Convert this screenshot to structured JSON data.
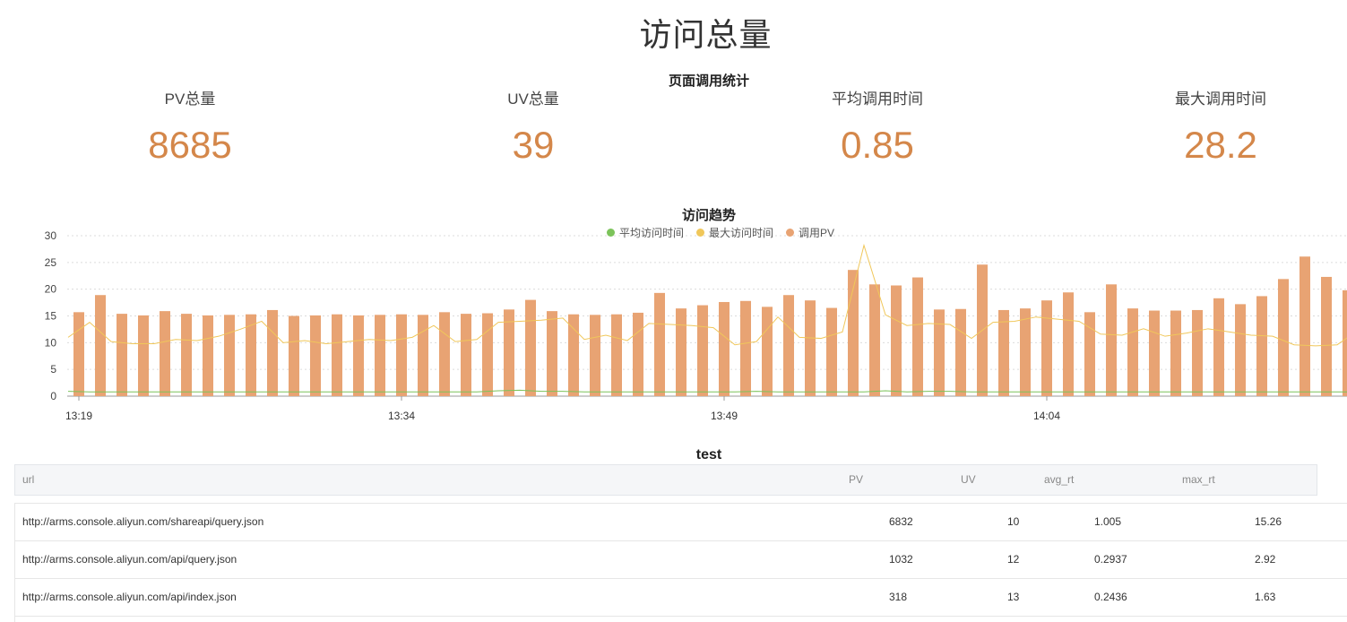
{
  "page": {
    "title": "访问总量"
  },
  "stats": {
    "title": "页面调用统计",
    "kpis": [
      {
        "label": "PV总量",
        "value": "8685"
      },
      {
        "label": "UV总量",
        "value": "39"
      },
      {
        "label": "平均调用时间",
        "value": "0.85"
      },
      {
        "label": "最大调用时间",
        "value": "28.2"
      }
    ]
  },
  "colors": {
    "accent": "#d4874a",
    "bar": "#e8a373",
    "avg_line": "#7cc35a",
    "max_line": "#f0c75a"
  },
  "chart_data": {
    "type": "bar",
    "title": "访问趋势",
    "ylim": [
      0,
      30
    ],
    "yticks": [
      "0",
      "5",
      "10",
      "15",
      "20",
      "25",
      "30"
    ],
    "xticks": [
      "13:19",
      "13:34",
      "13:49",
      "14:04"
    ],
    "grid": true,
    "legend_position": "top",
    "series": [
      {
        "name": "平均访问时间",
        "type": "line",
        "values": [
          0.9,
          0.8,
          0.8,
          0.8,
          0.8,
          0.8,
          0.8,
          0.8,
          0.8,
          0.8,
          0.8,
          0.8,
          0.8,
          0.8,
          0.8,
          0.8,
          0.8,
          0.8,
          0.8,
          0.8,
          1.0,
          1.1,
          0.9,
          0.9,
          0.8,
          0.8,
          0.8,
          0.8,
          0.8,
          0.8,
          0.8,
          0.8,
          0.9,
          0.8,
          0.8,
          0.8,
          0.8,
          0.8,
          1.0,
          0.8,
          0.9,
          0.9,
          0.8,
          0.8,
          0.8,
          0.8,
          0.8,
          0.8,
          0.8,
          0.8,
          0.8,
          0.8,
          0.8,
          0.8,
          0.8,
          0.8,
          0.8,
          0.8,
          0.8,
          0.8,
          0.8
        ]
      },
      {
        "name": "最大访问时间",
        "type": "line",
        "values": [
          11,
          13.8,
          10.2,
          9.8,
          9.8,
          10.6,
          10.4,
          11.2,
          12.5,
          14,
          10,
          10.4,
          9.8,
          10.2,
          10.6,
          10.4,
          11,
          13.2,
          10.2,
          10.6,
          13.8,
          14,
          14.2,
          14.6,
          10.6,
          11.4,
          10.4,
          13.6,
          13.4,
          13.2,
          12.8,
          9.6,
          10.2,
          14.8,
          11,
          10.8,
          12,
          28.2,
          15.2,
          13.2,
          13.6,
          13.4,
          10.8,
          13.8,
          14,
          14.8,
          14.4,
          14,
          11.6,
          11.4,
          12.6,
          11.2,
          11.8,
          12.6,
          12,
          11.4,
          11.2,
          9.6,
          9.4,
          9.6,
          12.4,
          9.4
        ]
      },
      {
        "name": "调用PV",
        "type": "bar",
        "values": [
          15.7,
          18.9,
          15.4,
          15.1,
          15.9,
          15.4,
          15.1,
          15.2,
          15.3,
          16.1,
          15,
          15.1,
          15.3,
          15.1,
          15.2,
          15.3,
          15.2,
          15.7,
          15.4,
          15.5,
          16.2,
          18,
          15.9,
          15.3,
          15.2,
          15.3,
          15.6,
          19.3,
          16.4,
          17,
          17.6,
          17.8,
          16.7,
          18.9,
          17.9,
          16.5,
          23.6,
          20.9,
          20.7,
          22.2,
          16.2,
          16.3,
          24.6,
          16.1,
          16.4,
          17.9,
          19.4,
          15.7,
          20.9,
          16.4,
          16,
          16,
          16.1,
          18.3,
          17.2,
          18.7,
          21.9,
          26.1,
          22.3,
          19.8
        ]
      }
    ]
  },
  "table": {
    "title": "test",
    "columns": [
      "url",
      "PV",
      "UV",
      "avg_rt",
      "max_rt"
    ],
    "rows": [
      [
        "http://arms.console.aliyun.com/shareapi/query.json",
        "6832",
        "10",
        "1.005",
        "15.26"
      ],
      [
        "http://arms.console.aliyun.com/api/query.json",
        "1032",
        "12",
        "0.2937",
        "2.92"
      ],
      [
        "http://arms.console.aliyun.com/api/index.json",
        "318",
        "13",
        "0.2436",
        "1.63"
      ]
    ]
  }
}
